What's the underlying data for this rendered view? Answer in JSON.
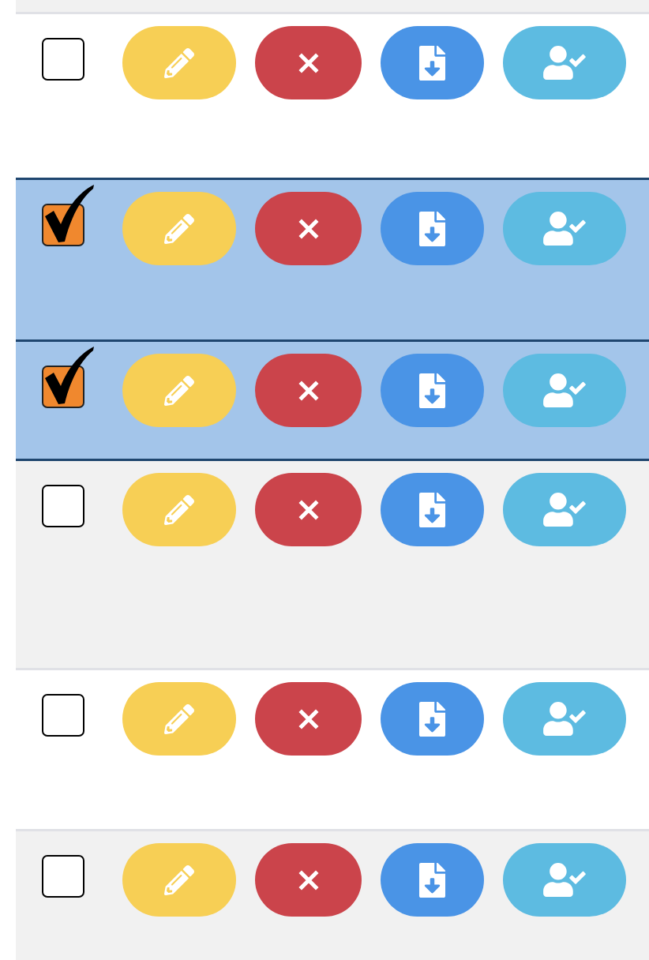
{
  "rows": [
    {
      "selected": false,
      "checked": false,
      "actions": [
        {
          "kind": "edit"
        },
        {
          "kind": "delete"
        },
        {
          "kind": "download"
        },
        {
          "kind": "approve"
        }
      ]
    },
    {
      "selected": true,
      "checked": true,
      "actions": [
        {
          "kind": "edit"
        },
        {
          "kind": "delete"
        },
        {
          "kind": "download"
        },
        {
          "kind": "approve"
        }
      ]
    },
    {
      "selected": true,
      "checked": true,
      "actions": [
        {
          "kind": "edit"
        },
        {
          "kind": "delete"
        },
        {
          "kind": "download"
        },
        {
          "kind": "approve"
        }
      ]
    },
    {
      "selected": false,
      "checked": false,
      "actions": [
        {
          "kind": "edit"
        },
        {
          "kind": "delete"
        },
        {
          "kind": "download"
        },
        {
          "kind": "approve"
        }
      ]
    },
    {
      "selected": false,
      "checked": false,
      "actions": [
        {
          "kind": "edit"
        },
        {
          "kind": "delete"
        },
        {
          "kind": "download"
        },
        {
          "kind": "approve"
        }
      ]
    },
    {
      "selected": false,
      "checked": false,
      "actions": [
        {
          "kind": "edit"
        },
        {
          "kind": "delete"
        },
        {
          "kind": "download"
        },
        {
          "kind": "approve"
        }
      ]
    }
  ]
}
